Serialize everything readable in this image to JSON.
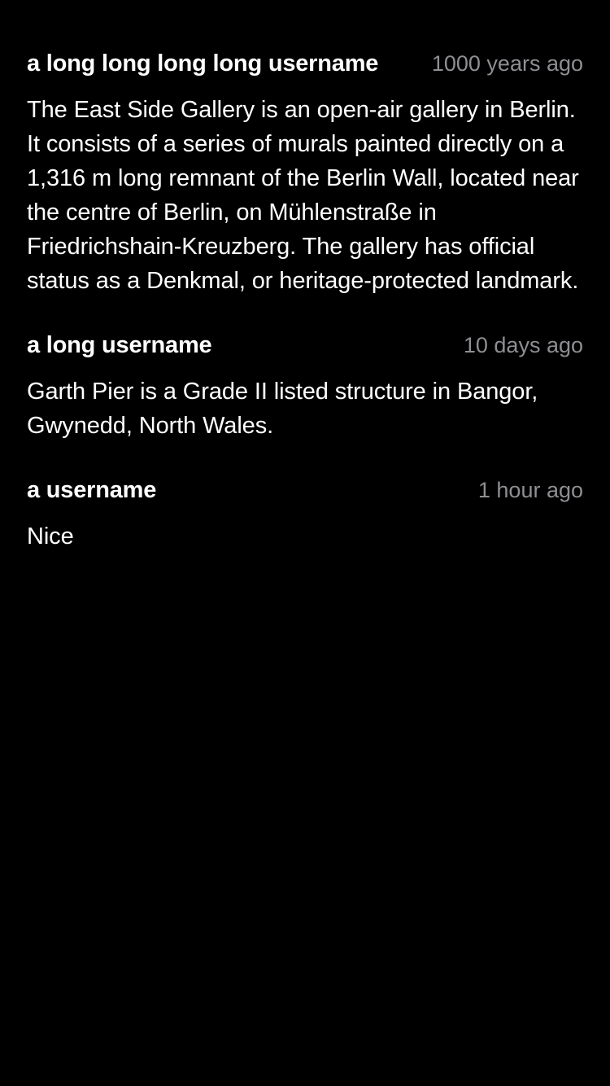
{
  "comments": [
    {
      "username": "a long long long long username",
      "time": "1000 years ago",
      "text": "The East Side Gallery is an open-air gallery in Berlin. It consists of a series of murals painted directly on a 1,316 m long remnant of the Berlin Wall, located near the centre of Berlin, on Mühlenstraße in Friedrichshain-Kreuzberg. The gallery has official status as a Denkmal, or heritage-protected landmark."
    },
    {
      "username": "a long username",
      "time": "10 days ago",
      "text": "Garth Pier is a Grade II listed structure in Bangor, Gwynedd, North Wales."
    },
    {
      "username": "a username",
      "time": "1 hour ago",
      "text": "Nice"
    }
  ],
  "colors": {
    "background": "#000000",
    "text": "#ffffff",
    "timestamp": "#8e8e93"
  }
}
